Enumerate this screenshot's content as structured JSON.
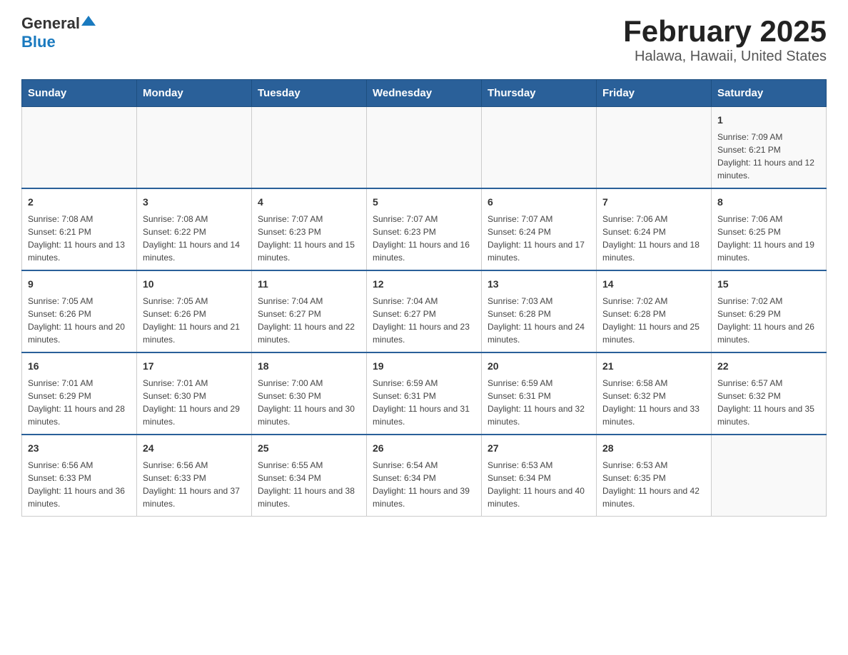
{
  "header": {
    "logo_general": "General",
    "logo_blue": "Blue",
    "title": "February 2025",
    "subtitle": "Halawa, Hawaii, United States"
  },
  "days_of_week": [
    "Sunday",
    "Monday",
    "Tuesday",
    "Wednesday",
    "Thursday",
    "Friday",
    "Saturday"
  ],
  "weeks": [
    [
      {
        "day": "",
        "info": ""
      },
      {
        "day": "",
        "info": ""
      },
      {
        "day": "",
        "info": ""
      },
      {
        "day": "",
        "info": ""
      },
      {
        "day": "",
        "info": ""
      },
      {
        "day": "",
        "info": ""
      },
      {
        "day": "1",
        "info": "Sunrise: 7:09 AM\nSunset: 6:21 PM\nDaylight: 11 hours and 12 minutes."
      }
    ],
    [
      {
        "day": "2",
        "info": "Sunrise: 7:08 AM\nSunset: 6:21 PM\nDaylight: 11 hours and 13 minutes."
      },
      {
        "day": "3",
        "info": "Sunrise: 7:08 AM\nSunset: 6:22 PM\nDaylight: 11 hours and 14 minutes."
      },
      {
        "day": "4",
        "info": "Sunrise: 7:07 AM\nSunset: 6:23 PM\nDaylight: 11 hours and 15 minutes."
      },
      {
        "day": "5",
        "info": "Sunrise: 7:07 AM\nSunset: 6:23 PM\nDaylight: 11 hours and 16 minutes."
      },
      {
        "day": "6",
        "info": "Sunrise: 7:07 AM\nSunset: 6:24 PM\nDaylight: 11 hours and 17 minutes."
      },
      {
        "day": "7",
        "info": "Sunrise: 7:06 AM\nSunset: 6:24 PM\nDaylight: 11 hours and 18 minutes."
      },
      {
        "day": "8",
        "info": "Sunrise: 7:06 AM\nSunset: 6:25 PM\nDaylight: 11 hours and 19 minutes."
      }
    ],
    [
      {
        "day": "9",
        "info": "Sunrise: 7:05 AM\nSunset: 6:26 PM\nDaylight: 11 hours and 20 minutes."
      },
      {
        "day": "10",
        "info": "Sunrise: 7:05 AM\nSunset: 6:26 PM\nDaylight: 11 hours and 21 minutes."
      },
      {
        "day": "11",
        "info": "Sunrise: 7:04 AM\nSunset: 6:27 PM\nDaylight: 11 hours and 22 minutes."
      },
      {
        "day": "12",
        "info": "Sunrise: 7:04 AM\nSunset: 6:27 PM\nDaylight: 11 hours and 23 minutes."
      },
      {
        "day": "13",
        "info": "Sunrise: 7:03 AM\nSunset: 6:28 PM\nDaylight: 11 hours and 24 minutes."
      },
      {
        "day": "14",
        "info": "Sunrise: 7:02 AM\nSunset: 6:28 PM\nDaylight: 11 hours and 25 minutes."
      },
      {
        "day": "15",
        "info": "Sunrise: 7:02 AM\nSunset: 6:29 PM\nDaylight: 11 hours and 26 minutes."
      }
    ],
    [
      {
        "day": "16",
        "info": "Sunrise: 7:01 AM\nSunset: 6:29 PM\nDaylight: 11 hours and 28 minutes."
      },
      {
        "day": "17",
        "info": "Sunrise: 7:01 AM\nSunset: 6:30 PM\nDaylight: 11 hours and 29 minutes."
      },
      {
        "day": "18",
        "info": "Sunrise: 7:00 AM\nSunset: 6:30 PM\nDaylight: 11 hours and 30 minutes."
      },
      {
        "day": "19",
        "info": "Sunrise: 6:59 AM\nSunset: 6:31 PM\nDaylight: 11 hours and 31 minutes."
      },
      {
        "day": "20",
        "info": "Sunrise: 6:59 AM\nSunset: 6:31 PM\nDaylight: 11 hours and 32 minutes."
      },
      {
        "day": "21",
        "info": "Sunrise: 6:58 AM\nSunset: 6:32 PM\nDaylight: 11 hours and 33 minutes."
      },
      {
        "day": "22",
        "info": "Sunrise: 6:57 AM\nSunset: 6:32 PM\nDaylight: 11 hours and 35 minutes."
      }
    ],
    [
      {
        "day": "23",
        "info": "Sunrise: 6:56 AM\nSunset: 6:33 PM\nDaylight: 11 hours and 36 minutes."
      },
      {
        "day": "24",
        "info": "Sunrise: 6:56 AM\nSunset: 6:33 PM\nDaylight: 11 hours and 37 minutes."
      },
      {
        "day": "25",
        "info": "Sunrise: 6:55 AM\nSunset: 6:34 PM\nDaylight: 11 hours and 38 minutes."
      },
      {
        "day": "26",
        "info": "Sunrise: 6:54 AM\nSunset: 6:34 PM\nDaylight: 11 hours and 39 minutes."
      },
      {
        "day": "27",
        "info": "Sunrise: 6:53 AM\nSunset: 6:34 PM\nDaylight: 11 hours and 40 minutes."
      },
      {
        "day": "28",
        "info": "Sunrise: 6:53 AM\nSunset: 6:35 PM\nDaylight: 11 hours and 42 minutes."
      },
      {
        "day": "",
        "info": ""
      }
    ]
  ]
}
